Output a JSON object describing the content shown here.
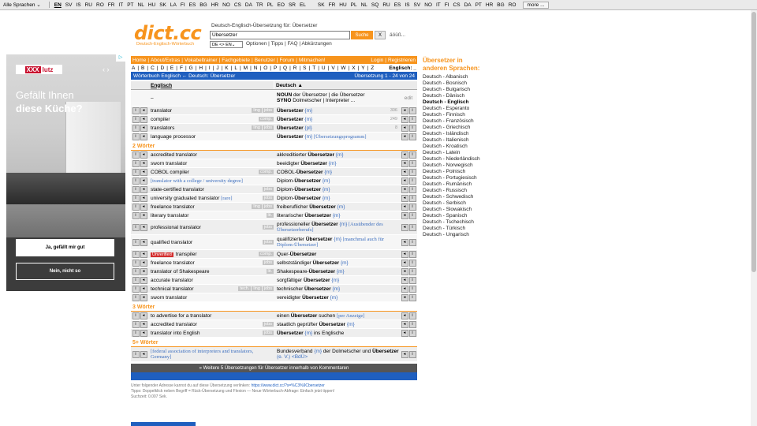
{
  "langbar": {
    "select": "Alle Sprachen",
    "group1": [
      "EN",
      "SV",
      "IS",
      "RU",
      "RO",
      "FR",
      "IT",
      "PT",
      "NL",
      "HU",
      "SK",
      "LA",
      "FI",
      "ES",
      "BG",
      "HR",
      "NO",
      "CS",
      "DA",
      "TR",
      "PL",
      "EO",
      "SR",
      "EL"
    ],
    "group2": [
      "SK",
      "FR",
      "HU",
      "PL",
      "NL",
      "SQ",
      "RU",
      "ES",
      "IS",
      "SV",
      "NO",
      "IT",
      "FI",
      "CS",
      "DA",
      "PT",
      "HR",
      "BG",
      "RO"
    ],
    "more": "more ..."
  },
  "logo": {
    "title": "dict.cc",
    "subtitle": "Deutsch-Englisch-Wörterbuch"
  },
  "search": {
    "caption": "Deutsch-Englisch-Übersetzung für: Übersetzer",
    "value": "Übersetzer",
    "button": "Suche",
    "clear": "X",
    "extra": "äöüß...",
    "direction": "DE <> EN",
    "options": "Optionen | Tipps | FAQ | Abkürzungen"
  },
  "ad": {
    "brand_x": "XXX",
    "brand": "lutz",
    "headline1": "Gefällt Ihnen",
    "headline2": "diese Küche?",
    "yes": "Ja, gefällt mir gut",
    "no": "Nein, nicht so",
    "arrows": "‹ ›",
    "adchoice": "▷"
  },
  "nav": {
    "items": [
      "Home",
      "About/Extras",
      "Vokabeltrainer",
      "Fachgebiete",
      "Benutzer",
      "Forum",
      "Mitmachen!"
    ],
    "login": "Login",
    "register": "Registrieren"
  },
  "alphabet": [
    "A",
    "B",
    "C",
    "D",
    "E",
    "F",
    "G",
    "H",
    "I",
    "J",
    "K",
    "L",
    "M",
    "N",
    "O",
    "P",
    "Q",
    "R",
    "S",
    "T",
    "U",
    "V",
    "W",
    "X",
    "Y",
    "Z"
  ],
  "alpha_lang": "Englisch: _",
  "bluebar": {
    "left": "Wörterbuch Englisch ← Deutsch: Übersetzer",
    "right": "Übersetzung 1 - 24 von 24"
  },
  "columns": {
    "en": "Englisch",
    "de": "Deutsch ▲"
  },
  "edit_label": "edit",
  "noun_line": {
    "label": "NOUN",
    "text": "der Übersetzer | die Übersetzer"
  },
  "syno_line": {
    "label": "SYNO",
    "text": "Dolmetscher | Interpreter ..."
  },
  "section1": [
    {
      "en": "translator",
      "tags": [
        "ling",
        "jobs"
      ],
      "de": "Übersetzer",
      "g": "{m}",
      "cnt": "306"
    },
    {
      "en": "compiler",
      "tags": [
        "comp."
      ],
      "de": "Übersetzer",
      "g": "{m}",
      "cnt": "249"
    },
    {
      "en": "translators",
      "tags": [
        "ling",
        "jobs"
      ],
      "de": "Übersetzer",
      "g": "{pl}",
      "cnt": "8"
    },
    {
      "en": "language processor",
      "tags": [],
      "de": "Übersetzer",
      "g": "{m}",
      "note": "[Übersetzungsprogramm]",
      "cnt": ""
    }
  ],
  "section2_title": "2 Wörter",
  "section2": [
    {
      "en": "accredited translator",
      "tags": [],
      "pre": "akkreditierter ",
      "kw": "Übersetzer",
      "g": "{m}"
    },
    {
      "en": "sworn translator",
      "tags": [],
      "pre": "beeidigter ",
      "kw": "Übersetzer",
      "g": "{m}"
    },
    {
      "en": "COBOL compiler",
      "tags": [
        "comp."
      ],
      "pre": "COBOL-",
      "kw": "Übersetzer",
      "g": "{m}"
    },
    {
      "en": "[translator with a college / university degree]",
      "serif": true,
      "tags": [],
      "pre": "Diplom-",
      "kw": "Übersetzer",
      "g": "{m}"
    },
    {
      "en": "state-certified translator",
      "tags": [
        "jobs"
      ],
      "pre": "Diplom-",
      "kw": "Übersetzer",
      "g": "{m}"
    },
    {
      "en": "university graduated translator",
      "rare": "[rare]",
      "tags": [
        "jobs"
      ],
      "pre": "Diplom-",
      "kw": "Übersetzer",
      "g": "{m}"
    },
    {
      "en": "freelance translator",
      "tags": [
        "ling",
        "jobs"
      ],
      "pre": "freiberuflicher ",
      "kw": "Übersetzer",
      "g": "{m}"
    },
    {
      "en": "literary translator",
      "tags": [
        "lit."
      ],
      "pre": "literarischer ",
      "kw": "Übersetzer",
      "g": "{m}"
    },
    {
      "en": "professional translator",
      "tags": [
        "jobs"
      ],
      "pre": "professioneller ",
      "kw": "Übersetzer",
      "g": "{m}",
      "note": "[Ausübender des Übersetzerberufs]",
      "tall": true
    },
    {
      "en": "qualified translator",
      "tags": [
        "jobs"
      ],
      "pre": "qualifizierter ",
      "kw": "Übersetzer",
      "g": "{m}",
      "note": "[manchmal auch für Diplom-Übersetzer]",
      "tall": true
    },
    {
      "en": "transpiler",
      "unverified": "Unverified",
      "tags": [
        "comp."
      ],
      "pre": "Quer-",
      "kw": "Übersetzer",
      "g": ""
    },
    {
      "en": "freelance translator",
      "tags": [
        "jobs"
      ],
      "pre": "selbstständiger ",
      "kw": "Übersetzer",
      "g": "{m}"
    },
    {
      "en": "translator of Shakespeare",
      "tags": [
        "lit."
      ],
      "pre": "Shakespeare-",
      "kw": "Übersetzer",
      "g": "{m}"
    },
    {
      "en": "accurate translator",
      "tags": [],
      "pre": "sorgfältiger ",
      "kw": "Übersetzer",
      "g": "{m}"
    },
    {
      "en": "technical translator",
      "tags": [
        "tech.",
        "ling",
        "jobs"
      ],
      "pre": "technischer ",
      "kw": "Übersetzer",
      "g": "{m}"
    },
    {
      "en": "sworn translator",
      "tags": [],
      "pre": "vereidigter ",
      "kw": "Übersetzer",
      "g": "{m}"
    }
  ],
  "section3_title": "3 Wörter",
  "section3": [
    {
      "en": "to advertise for a translator",
      "tags": [],
      "pre": "einen ",
      "kw": "Übersetzer",
      "post": " suchen ",
      "note": "[per Anzeige]",
      "g": ""
    },
    {
      "en": "accredited translator",
      "tags": [
        "jobs"
      ],
      "pre": "staatlich geprüfter ",
      "kw": "Übersetzer",
      "g": "{m}"
    },
    {
      "en": "translator into English",
      "tags": [
        "jobs"
      ],
      "pre": "",
      "kw": "Übersetzer",
      "g": "{m}",
      "post": " ins Englische"
    }
  ],
  "section4_title": "5+ Wörter",
  "section4": [
    {
      "en": "[federal association of interpreters and translators, Germany]",
      "serif": true,
      "tags": [],
      "pre": "Bundesverband ",
      "g": "{m}",
      "post": " der Dolmetscher und ",
      "kw": "Übersetzer",
      "tail": " (e. V.) <BdÜ>",
      "tall": true
    }
  ],
  "more_bar": "» Weitere 5 Übersetzungen für Übersetzer innerhalb von Kommentaren",
  "footer": {
    "line1": "Unter folgender Adresse kannst du auf diese Übersetzung verlinken: ",
    "link": "https://www.dict.cc/?s=%C3%9Cbersetzer",
    "line2": "Tipps: Doppelklick neben Begriff = Rück-Übersetzung und Flexion — Neue Wörterbuch-Abfrage: Einfach jetzt tippen!",
    "line3": "Suchzeit: 0.007 Sek."
  },
  "right": {
    "head1": "Übersetzer in",
    "head2": "anderen Sprachen:",
    "items": [
      "Deutsch - Albanisch",
      "Deutsch - Bosnisch",
      "Deutsch - Bulgarisch",
      "Deutsch - Dänisch",
      "Deutsch - Englisch",
      "Deutsch - Esperanto",
      "Deutsch - Finnisch",
      "Deutsch - Französisch",
      "Deutsch - Griechisch",
      "Deutsch - Isländisch",
      "Deutsch - Italienisch",
      "Deutsch - Kroatisch",
      "Deutsch - Latein",
      "Deutsch - Niederländisch",
      "Deutsch - Norwegisch",
      "Deutsch - Polnisch",
      "Deutsch - Portugiesisch",
      "Deutsch - Rumänisch",
      "Deutsch - Russisch",
      "Deutsch - Schwedisch",
      "Deutsch - Serbisch",
      "Deutsch - Slowakisch",
      "Deutsch - Spanisch",
      "Deutsch - Tschechisch",
      "Deutsch - Türkisch",
      "Deutsch - Ungarisch"
    ],
    "current": "Deutsch - Englisch"
  }
}
